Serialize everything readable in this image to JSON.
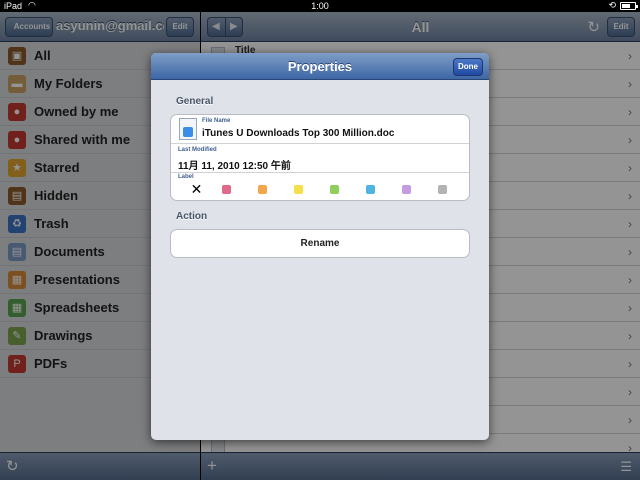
{
  "status": {
    "carrier": "iPad",
    "time": "1:00",
    "battery_level": 0.7
  },
  "left": {
    "back_label": "Accounts",
    "account": "asyunin@gmail.com",
    "edit_label": "Edit",
    "folders": [
      {
        "label": "All",
        "icon": "briefcase-icon",
        "color": "#8b5a2b"
      },
      {
        "label": "My Folders",
        "icon": "folder-icon",
        "color": "#c9a063"
      },
      {
        "label": "Owned by me",
        "icon": "person-icon",
        "color": "#c23a2f"
      },
      {
        "label": "Shared with me",
        "icon": "people-icon",
        "color": "#c23a2f"
      },
      {
        "label": "Starred",
        "icon": "star-icon",
        "color": "#e1a531"
      },
      {
        "label": "Hidden",
        "icon": "box-icon",
        "color": "#8b5a2b"
      },
      {
        "label": "Trash",
        "icon": "recycle-icon",
        "color": "#3b74c4"
      },
      {
        "label": "Documents",
        "icon": "document-icon",
        "color": "#7d99c6"
      },
      {
        "label": "Presentations",
        "icon": "presentation-icon",
        "color": "#d88a3a"
      },
      {
        "label": "Spreadsheets",
        "icon": "spreadsheet-icon",
        "color": "#5aa34e"
      },
      {
        "label": "Drawings",
        "icon": "drawing-icon",
        "color": "#7aa34e"
      },
      {
        "label": "PDFs",
        "icon": "pdf-icon",
        "color": "#c23a2f"
      }
    ]
  },
  "right": {
    "title": "All",
    "edit_label": "Edit",
    "rows": [
      {
        "title": "Title",
        "sub": ""
      },
      {
        "title": "",
        "sub": ""
      },
      {
        "title": "",
        "sub": ""
      },
      {
        "title": "",
        "sub": ""
      },
      {
        "title": "",
        "sub": ""
      },
      {
        "title": "",
        "sub": ""
      },
      {
        "title": "",
        "sub": ""
      },
      {
        "title": "",
        "sub": ""
      },
      {
        "title": "",
        "sub": ""
      },
      {
        "title": "",
        "sub": ""
      },
      {
        "title": "",
        "sub": ""
      },
      {
        "title": "",
        "sub": ""
      },
      {
        "title": "",
        "sub": ""
      },
      {
        "title": "",
        "sub": ""
      },
      {
        "title": "",
        "sub": ""
      }
    ]
  },
  "modal": {
    "title": "Properties",
    "done_label": "Done",
    "general_header": "General",
    "file_name_caption": "File Name",
    "file_name": "iTunes U Downloads Top 300 Million.doc",
    "last_modified_caption": "Last Modified",
    "last_modified": "11月 11, 2010 12:50 午前",
    "label_caption": "Label",
    "no_label_glyph": "✕",
    "label_colors": [
      "#e06a8a",
      "#f2a84a",
      "#f5df4a",
      "#8fd05a",
      "#4fb4e0",
      "#c59ce0",
      "#b4b4b4"
    ],
    "action_header": "Action",
    "rename_label": "Rename"
  }
}
